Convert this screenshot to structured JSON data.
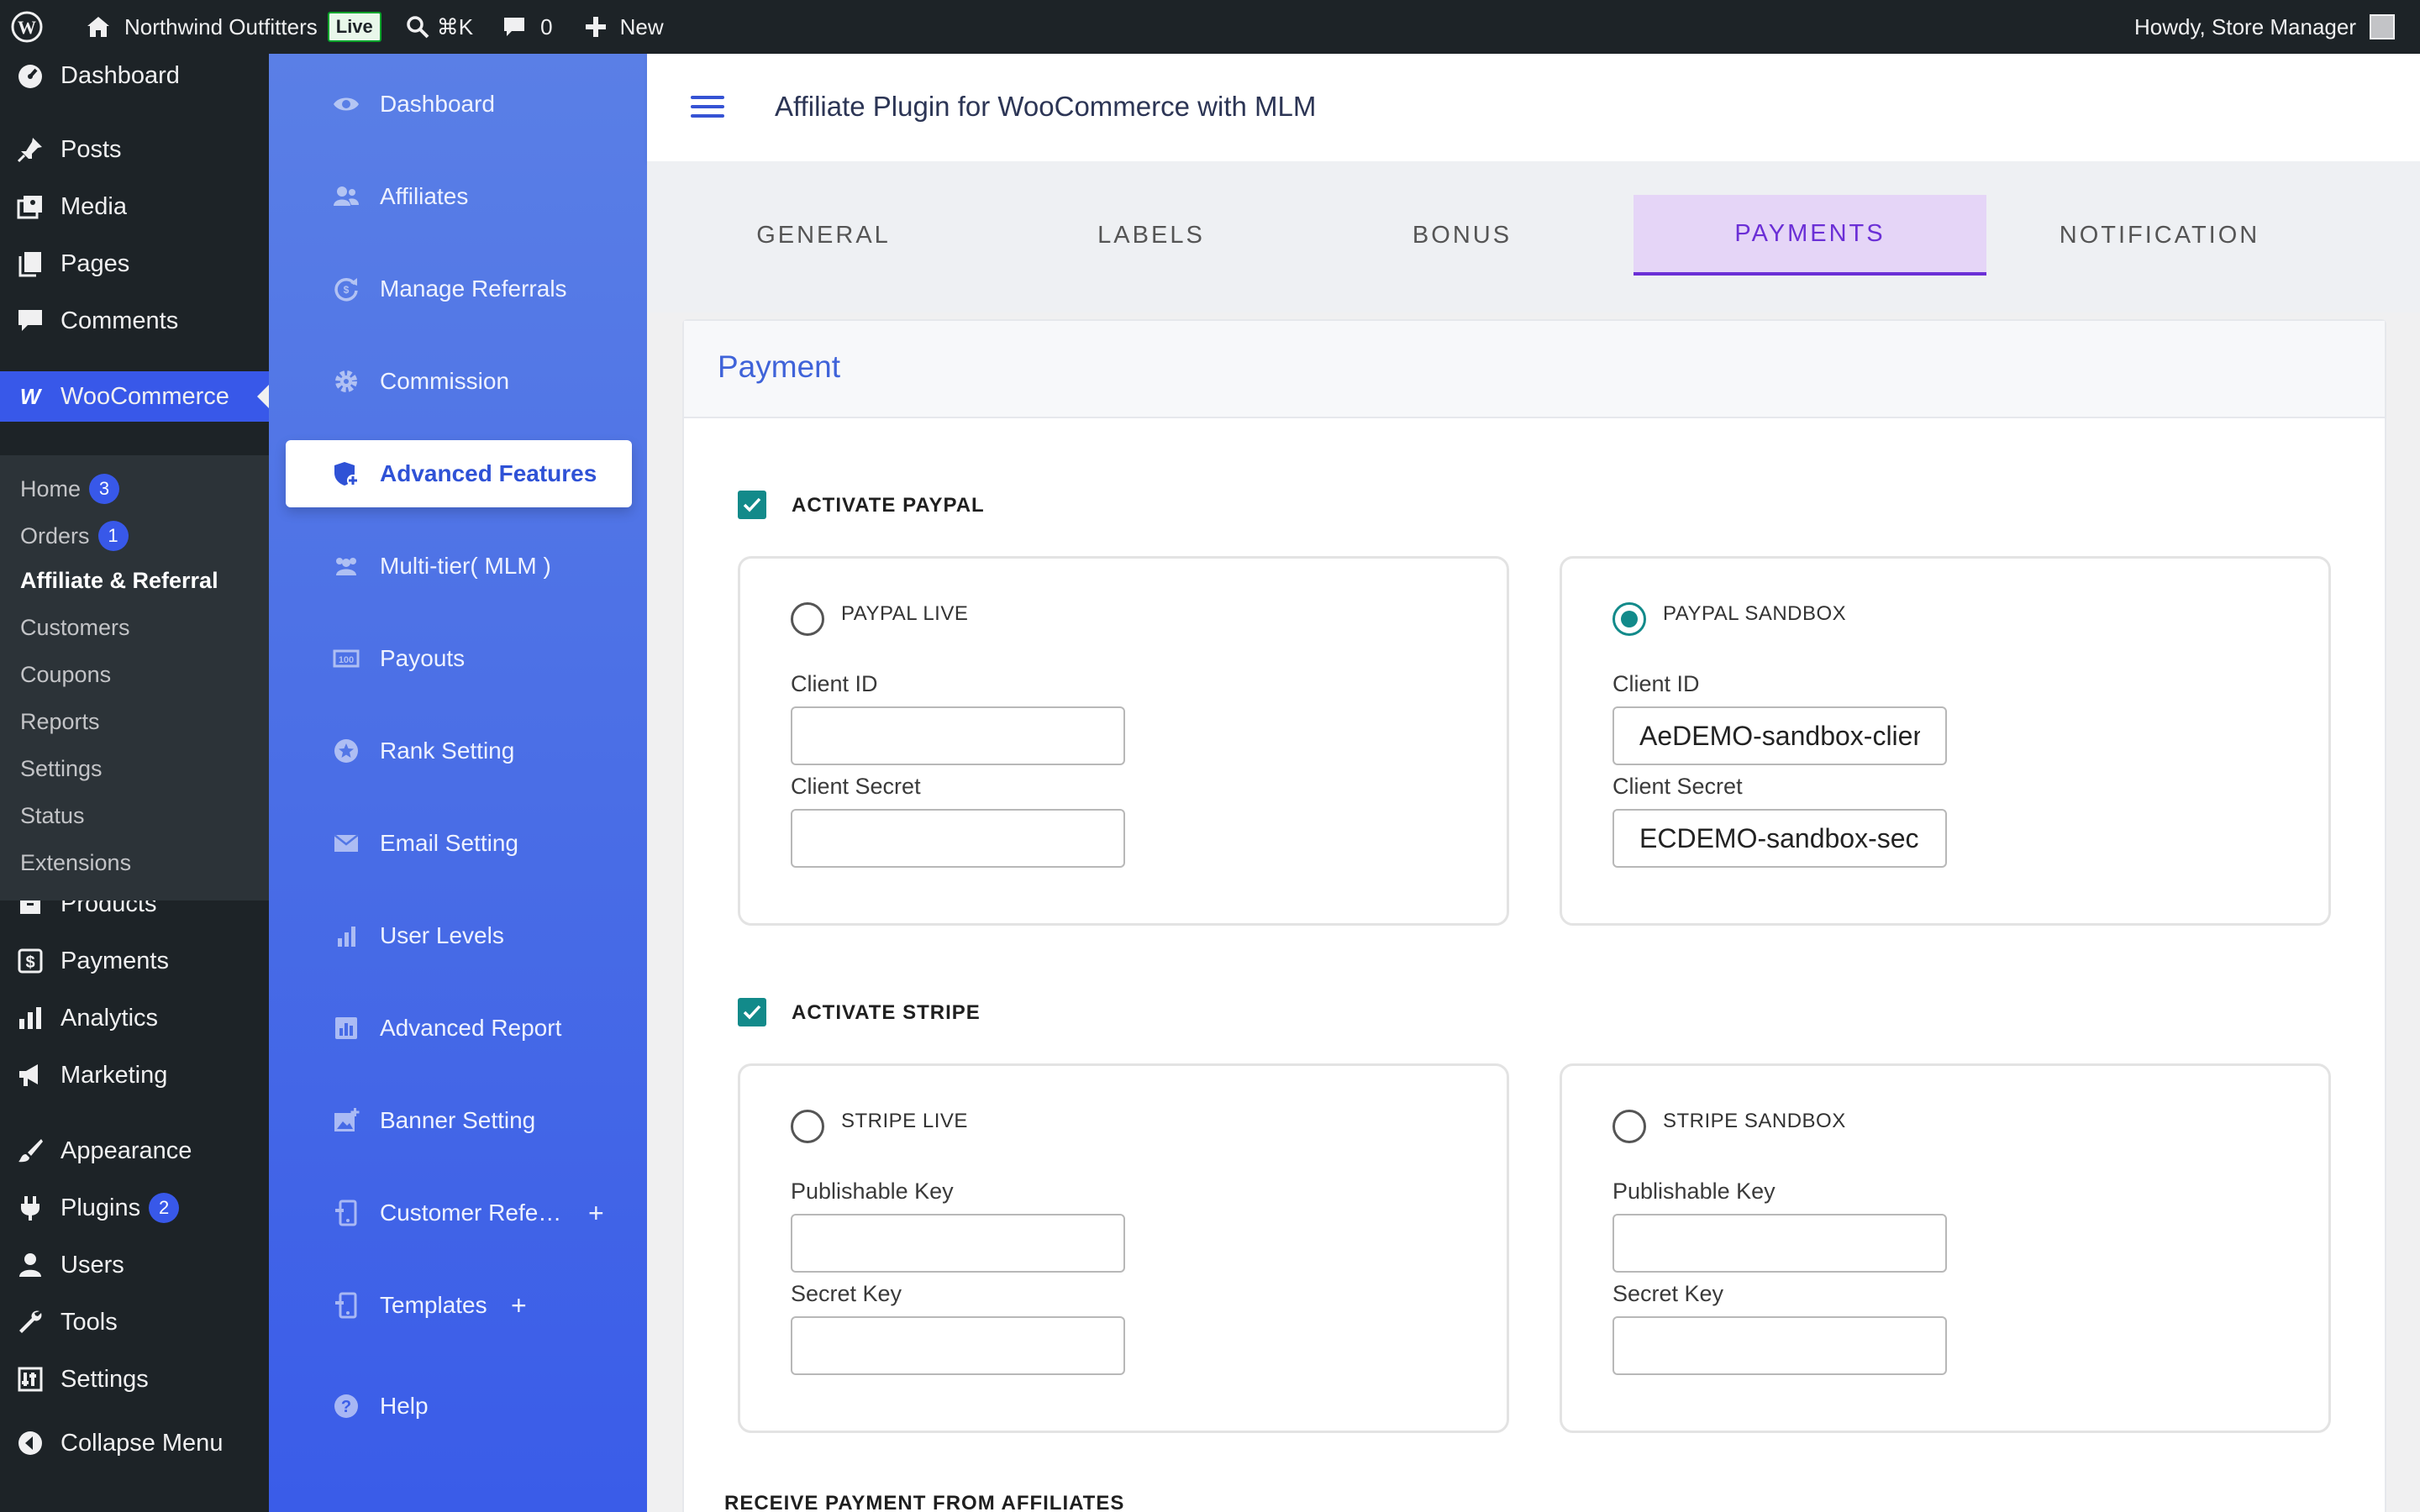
{
  "admin_bar": {
    "site_name": "Northwind Outfitters",
    "live_badge": "Live",
    "shortcut": "⌘K",
    "comments_count": "0",
    "new_label": "New",
    "howdy": "Howdy, Store Manager"
  },
  "admin_menu": {
    "items": [
      {
        "label": "Dashboard",
        "icon": "dashboard-icon"
      },
      {
        "label": "Posts",
        "icon": "pin-icon"
      },
      {
        "label": "Media",
        "icon": "media-icon"
      },
      {
        "label": "Pages",
        "icon": "pages-icon"
      },
      {
        "label": "Comments",
        "icon": "comment-icon"
      },
      {
        "label": "WooCommerce",
        "icon": "woo-icon"
      },
      {
        "label": "Products",
        "icon": "archive-icon"
      },
      {
        "label": "Payments",
        "icon": "dollar-icon"
      },
      {
        "label": "Analytics",
        "icon": "bar-chart-icon"
      },
      {
        "label": "Marketing",
        "icon": "megaphone-icon"
      },
      {
        "label": "Appearance",
        "icon": "brush-icon"
      },
      {
        "label": "Plugins",
        "icon": "plug-icon"
      },
      {
        "label": "Users",
        "icon": "user-icon"
      },
      {
        "label": "Tools",
        "icon": "wrench-icon"
      },
      {
        "label": "Settings",
        "icon": "settings-icon"
      },
      {
        "label": "Collapse Menu",
        "icon": "collapse-icon"
      }
    ],
    "plugins_badge": "2",
    "woo_submenu": [
      {
        "label": "Home",
        "badge": "3"
      },
      {
        "label": "Orders",
        "badge": "1"
      },
      {
        "label": "Affiliate & Referral"
      },
      {
        "label": "Customers"
      },
      {
        "label": "Coupons"
      },
      {
        "label": "Reports"
      },
      {
        "label": "Settings"
      },
      {
        "label": "Status"
      },
      {
        "label": "Extensions"
      }
    ]
  },
  "plugin_nav": {
    "items": [
      {
        "label": "Dashboard",
        "icon": "eye-icon"
      },
      {
        "label": "Affiliates",
        "icon": "users-icon"
      },
      {
        "label": "Manage Referrals",
        "icon": "refresh-icon"
      },
      {
        "label": "Commission",
        "icon": "gear-icon"
      },
      {
        "label": "Advanced Features",
        "icon": "shield-plus-icon"
      },
      {
        "label": "Multi-tier( MLM )",
        "icon": "group-icon"
      },
      {
        "label": "Payouts",
        "icon": "money-icon"
      },
      {
        "label": "Rank Setting",
        "icon": "star-icon"
      },
      {
        "label": "Email Setting",
        "icon": "mail-icon"
      },
      {
        "label": "User Levels",
        "icon": "levels-icon"
      },
      {
        "label": "Advanced Report",
        "icon": "report-icon"
      },
      {
        "label": "Banner Setting",
        "icon": "image-plus-icon"
      },
      {
        "label": "Customer Refe…",
        "icon": "device-icon"
      },
      {
        "label": "Templates",
        "icon": "device-icon"
      },
      {
        "label": "Help",
        "icon": "help-icon"
      }
    ],
    "expand_symbol": "+"
  },
  "header": {
    "title": "Affiliate Plugin for WooCommerce with MLM"
  },
  "tabs": [
    {
      "label": "GENERAL"
    },
    {
      "label": "LABELS"
    },
    {
      "label": "BONUS"
    },
    {
      "label": "PAYMENTS"
    },
    {
      "label": "NOTIFICATION"
    }
  ],
  "payment": {
    "card_title": "Payment",
    "paypal": {
      "activate_label": "ACTIVATE PAYPAL",
      "activated": true,
      "live": {
        "label": "PAYPAL LIVE",
        "selected": false,
        "client_id_label": "Client ID",
        "client_id": "",
        "client_secret_label": "Client Secret",
        "client_secret": ""
      },
      "sandbox": {
        "label": "PAYPAL SANDBOX",
        "selected": true,
        "client_id_label": "Client ID",
        "client_id": "AeDEMO-sandbox-client",
        "client_secret_label": "Client Secret",
        "client_secret": "ECDEMO-sandbox-secret"
      }
    },
    "stripe": {
      "activate_label": "ACTIVATE STRIPE",
      "activated": true,
      "live": {
        "label": "STRIPE LIVE",
        "selected": false,
        "publishable_label": "Publishable Key",
        "publishable": "",
        "secret_label": "Secret Key",
        "secret": ""
      },
      "sandbox": {
        "label": "STRIPE SANDBOX",
        "selected": false,
        "publishable_label": "Publishable Key",
        "publishable": "",
        "secret_label": "Secret Key",
        "secret": ""
      }
    },
    "receive_label": "RECEIVE PAYMENT FROM AFFILIATES"
  },
  "colors": {
    "wp_dark": "#1d2327",
    "wp_accent": "#3858e9",
    "plugin_blue": "#4a6ee6",
    "tab_active": "#6b2fd6",
    "teal": "#128a8a"
  }
}
